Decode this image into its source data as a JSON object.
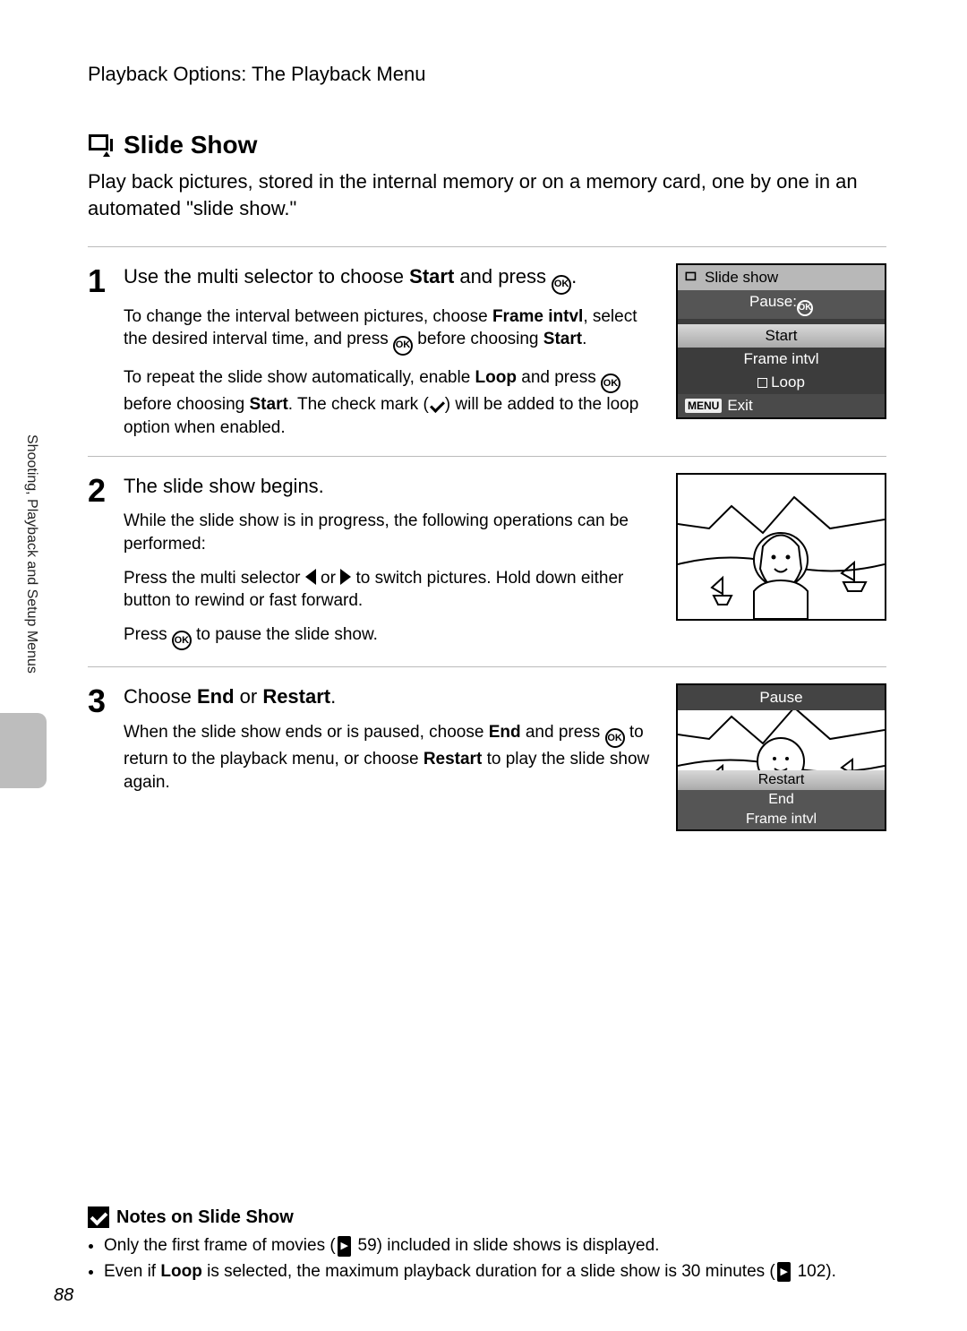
{
  "breadcrumb": "Playback Options: The Playback Menu",
  "sideLabel": "Shooting, Playback and Setup Menus",
  "pageNumber": "88",
  "section": {
    "title": "Slide Show",
    "intro": "Play back pictures, stored in the internal memory or on a memory card, one by one in an automated \"slide show.\""
  },
  "steps": [
    {
      "num": "1",
      "head_pre": "Use the multi selector to choose ",
      "head_bold": "Start",
      "head_post": " and press ",
      "paras": [
        {
          "plain_pre": "To change the interval between pictures, choose ",
          "b1": "Frame intvl",
          "mid1": ", select the desired interval time, and press ",
          "ok": true,
          "mid2": " before choosing ",
          "b2": "Start",
          "tail": "."
        },
        {
          "plain_pre": "To repeat the slide show automatically, enable ",
          "b1": "Loop",
          "mid1": " and press ",
          "ok": true,
          "mid2": " before choosing ",
          "b2": "Start",
          "tail": ". The check mark (",
          "check": true,
          "tail2": ") will be added to the loop option when enabled."
        }
      ],
      "lcd": {
        "title": "Slide show",
        "sub": "Pause:",
        "rows": [
          {
            "label": "Start",
            "selected": true
          },
          {
            "label": "Frame intvl",
            "selected": false
          },
          {
            "label": "Loop",
            "selected": false,
            "loop": true
          }
        ],
        "footerMenu": "MENU",
        "footerText": "Exit"
      }
    },
    {
      "num": "2",
      "head": "The slide show begins.",
      "p1": "While the slide show is in progress, the following operations can be performed:",
      "p2_pre": "Press the multi selector ",
      "p2_mid": " or ",
      "p2_post": " to switch pictures. Hold down either button to rewind or fast forward.",
      "p3_pre": "Press ",
      "p3_post": " to pause the slide show."
    },
    {
      "num": "3",
      "head_pre": "Choose ",
      "head_b1": "End",
      "head_mid": " or ",
      "head_b2": "Restart",
      "head_post": ".",
      "p_pre": "When the slide show ends or is paused, choose ",
      "p_b1": "End",
      "p_mid1": " and press ",
      "p_mid2": " to return to the playback menu, or choose ",
      "p_b2": "Restart",
      "p_post": " to play the slide show again.",
      "pausePanel": {
        "title": "Pause",
        "rows": [
          "Restart",
          "End",
          "Frame intvl"
        ]
      }
    }
  ],
  "notes": {
    "title": "Notes on Slide Show",
    "bullets": [
      {
        "pre": "Only the first frame of movies (",
        "ref": "59",
        "post": ") included in slide shows is displayed."
      },
      {
        "pre": "Even if ",
        "b": "Loop",
        "mid": " is selected, the maximum playback duration for a slide show is 30 minutes (",
        "ref": "102",
        "post": ")."
      }
    ]
  }
}
